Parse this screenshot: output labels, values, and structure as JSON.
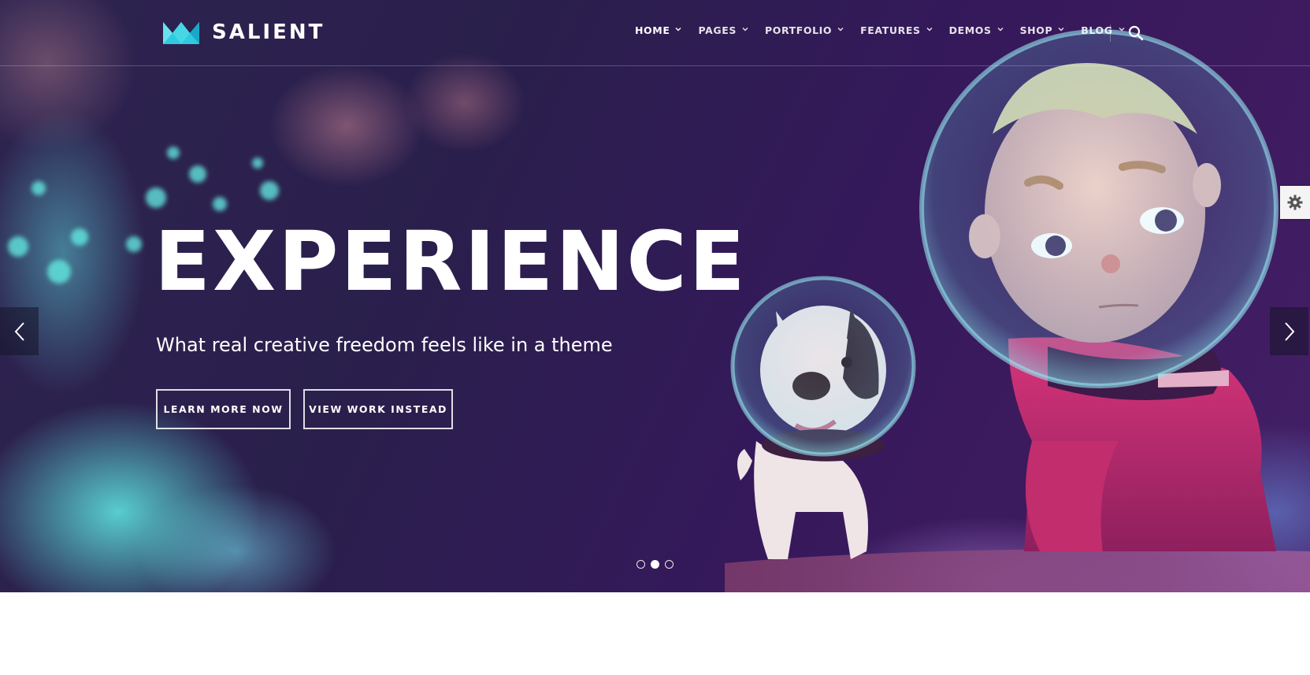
{
  "brand": {
    "name": "SALIENT",
    "logo_icon": "crown-logo-icon",
    "accent": "#3ed3e0"
  },
  "nav": {
    "items": [
      {
        "label": "HOME",
        "active": true
      },
      {
        "label": "PAGES",
        "active": false
      },
      {
        "label": "PORTFOLIO",
        "active": false
      },
      {
        "label": "FEATURES",
        "active": false
      },
      {
        "label": "DEMOS",
        "active": false
      },
      {
        "label": "SHOP",
        "active": false
      },
      {
        "label": "BLOG",
        "active": false
      }
    ],
    "search_icon": "search-icon"
  },
  "hero": {
    "headline": "EXPERIENCE",
    "subheadline": "What real creative freedom feels like in a theme",
    "buttons": [
      {
        "label": "LEARN MORE NOW"
      },
      {
        "label": "VIEW WORK INSTEAD"
      }
    ],
    "prev_icon": "chevron-left-icon",
    "next_icon": "chevron-right-icon",
    "slides_total": 3,
    "active_slide": 2
  },
  "settings_icon": "gear-icon"
}
